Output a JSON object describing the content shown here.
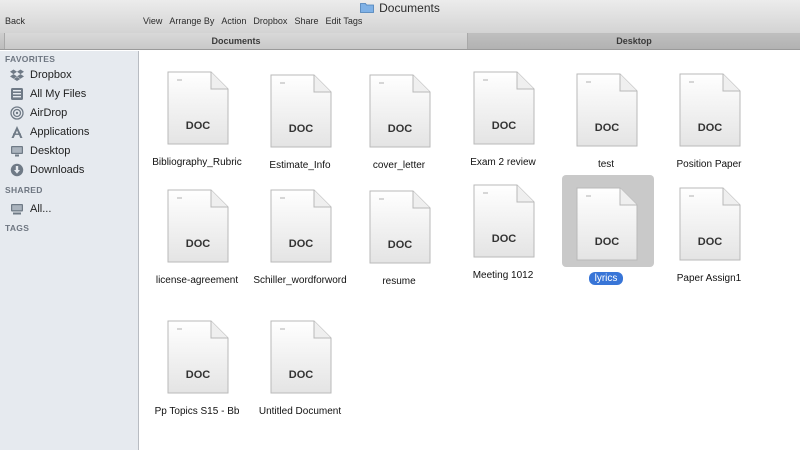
{
  "window": {
    "title": "Documents"
  },
  "toolbar": {
    "back_label": "Back",
    "menu": [
      "View",
      "Arrange By",
      "Action",
      "Dropbox",
      "Share",
      "Edit Tags"
    ]
  },
  "tabs": [
    {
      "label": "Documents",
      "active": true
    },
    {
      "label": "Desktop",
      "active": false
    }
  ],
  "sidebar": {
    "favorites_header": "FAVORITES",
    "favorites": [
      {
        "label": "Dropbox",
        "icon": "dropbox-icon"
      },
      {
        "label": "All My Files",
        "icon": "all-files-icon"
      },
      {
        "label": "AirDrop",
        "icon": "airdrop-icon"
      },
      {
        "label": "Applications",
        "icon": "applications-icon"
      },
      {
        "label": "Desktop",
        "icon": "desktop-icon"
      },
      {
        "label": "Downloads",
        "icon": "downloads-icon"
      }
    ],
    "shared_header": "SHARED",
    "shared": [
      {
        "label": "All...",
        "icon": "network-icon"
      }
    ],
    "tags_header": "TAGS"
  },
  "doc_badge": "DOC",
  "files": [
    {
      "name": "Bibliography_Rubric",
      "selected": false
    },
    {
      "name": "Estimate_Info",
      "selected": false
    },
    {
      "name": "cover_letter",
      "selected": false
    },
    {
      "name": "Exam 2 review",
      "selected": false
    },
    {
      "name": "test",
      "selected": false
    },
    {
      "name": "Position Paper",
      "selected": false
    },
    {
      "name": "license-agreement",
      "selected": false
    },
    {
      "name": "Schiller_wordforword",
      "selected": false
    },
    {
      "name": "resume",
      "selected": false
    },
    {
      "name": "Meeting 1012",
      "selected": false
    },
    {
      "name": "lyrics",
      "selected": true
    },
    {
      "name": "Paper Assign1",
      "selected": false
    },
    {
      "name": "Pp Topics S15 - Bb",
      "selected": false
    },
    {
      "name": "Untitled Document",
      "selected": false
    }
  ]
}
